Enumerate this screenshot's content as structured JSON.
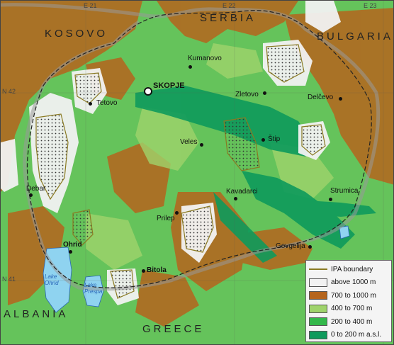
{
  "countries": {
    "kosovo": "KOSOVO",
    "serbia": "SERBIA",
    "bulgaria": "BULGARIA",
    "albania": "ALBANIA",
    "greece": "GREECE"
  },
  "grid": {
    "e21": "E 21",
    "e22": "E 22",
    "e23": "E 23",
    "n42": "N 42",
    "n41": "N 41"
  },
  "cities": {
    "capital": "SKOPJE",
    "kumanovo": "Kumanovo",
    "tetovo": "Tetovo",
    "zletovo": "Zletovo",
    "delcevo": "Delčevo",
    "veles": "Veles",
    "stip": "Štip",
    "debar": "Debar",
    "kavadarci": "Kavadarci",
    "strumica": "Strumica",
    "prilep": "Prilep",
    "gevgelija": "Gevgelija",
    "ohrid": "Ohrid",
    "bitola": "Bitola"
  },
  "lakes": {
    "ohrid_line1": "Lake",
    "ohrid_line2": "Ohrid",
    "prespa_line1": "Lake",
    "prespa_line2": "Prespa"
  },
  "legend": {
    "items": [
      {
        "label": "IPA boundary",
        "kind": "line",
        "color": "#8a7a22"
      },
      {
        "label": "above 1000 m",
        "kind": "fill",
        "color": "#f2f2f2"
      },
      {
        "label": "700 to 1000 m",
        "kind": "fill",
        "color": "#b5651d"
      },
      {
        "label": "400 to 700 m",
        "kind": "fill",
        "color": "#9fd36b"
      },
      {
        "label": "200 to 400 m",
        "kind": "fill",
        "color": "#33b84a"
      },
      {
        "label": "0 to 200 m a.s.l.",
        "kind": "fill",
        "color": "#0e9a5c"
      }
    ]
  }
}
